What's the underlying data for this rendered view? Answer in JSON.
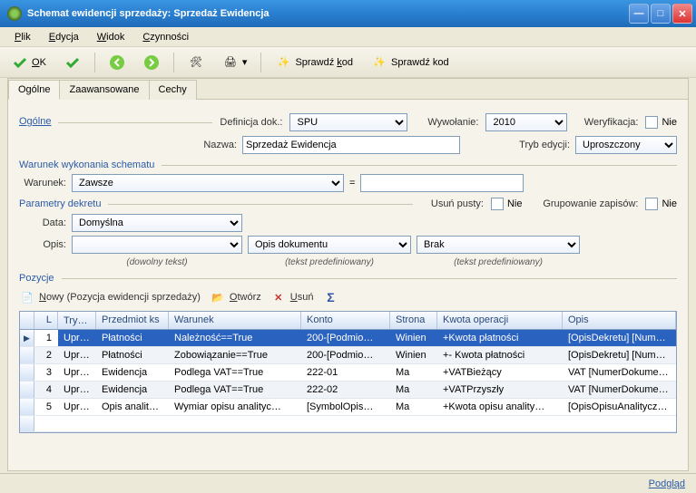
{
  "window": {
    "title": "Schemat ewidencji sprzedaży: Sprzedaż Ewidencja"
  },
  "menu": {
    "plik": "Plik",
    "edycja": "Edycja",
    "widok": "Widok",
    "czynnosci": "Czynności"
  },
  "toolbar": {
    "ok": "OK",
    "sprawdz_kod": "Sprawdź kod",
    "sprawdz_kod2": "Sprawdź kod"
  },
  "tabs": {
    "ogolne": "Ogólne",
    "zaawansowane": "Zaawansowane",
    "cechy": "Cechy"
  },
  "general": {
    "group_label": "Ogólne",
    "def_dok_label": "Definicja dok.:",
    "def_dok_value": "SPU",
    "wywolanie_label": "Wywołanie:",
    "wywolanie_value": "2010",
    "weryfikacja_label": "Weryfikacja:",
    "weryfikacja_value": "Nie",
    "nazwa_label": "Nazwa:",
    "nazwa_value": "Sprzedaż Ewidencja",
    "tryb_label": "Tryb edycji:",
    "tryb_value": "Uproszczony"
  },
  "warunek_group": {
    "label": "Warunek wykonania schematu",
    "warunek_label": "Warunek:",
    "warunek_value": "Zawsze",
    "eq": "=",
    "extra_value": ""
  },
  "parametry": {
    "label": "Parametry dekretu",
    "usun_label": "Usuń pusty:",
    "usun_value": "Nie",
    "grup_label": "Grupowanie zapisów:",
    "grup_value": "Nie",
    "data_label": "Data:",
    "data_value": "Domyślna",
    "opis_label": "Opis:",
    "opis1_value": "",
    "opis2_value": "Opis dokumentu",
    "opis3_value": "Brak",
    "hint1": "(dowolny tekst)",
    "hint2": "(tekst predefiniowany)",
    "hint3": "(tekst predefiniowany)"
  },
  "pozycje": {
    "label": "Pozycje",
    "nowy": "Nowy (Pozycja ewidencji sprzedaży)",
    "otworz": "Otwórz",
    "usun": "Usuń"
  },
  "grid": {
    "headers": {
      "l": "L",
      "tryb": "Tryb",
      "przedmiot": "Przedmiot ks",
      "warunek": "Warunek",
      "konto": "Konto",
      "strona": "Strona",
      "kwota": "Kwota operacji",
      "opis": "Opis"
    },
    "rows": [
      {
        "l": "1",
        "tryb": "Upr…",
        "przedmiot": "Płatności",
        "warunek": "Należność==True",
        "konto": "200-[Podmio…",
        "strona": "Winien",
        "kwota": "+Kwota płatności",
        "opis": "[OpisDekretu] [NumerDo…"
      },
      {
        "l": "2",
        "tryb": "Upr…",
        "przedmiot": "Płatności",
        "warunek": "Zobowiązanie==True",
        "konto": "200-[Podmio…",
        "strona": "Winien",
        "kwota": "+- Kwota płatności",
        "opis": "[OpisDekretu] [NumerDo…"
      },
      {
        "l": "3",
        "tryb": "Upr…",
        "przedmiot": "Ewidencja",
        "warunek": "Podlega VAT==True",
        "konto": "222-01",
        "strona": "Ma",
        "kwota": "+VATBieżący",
        "opis": "VAT [NumerDokumentu]"
      },
      {
        "l": "4",
        "tryb": "Upr…",
        "przedmiot": "Ewidencja",
        "warunek": "Podlega VAT==True",
        "konto": "222-02",
        "strona": "Ma",
        "kwota": "+VATPrzyszły",
        "opis": "VAT [NumerDokumentu]"
      },
      {
        "l": "5",
        "tryb": "Upr…",
        "przedmiot": "Opis analit…",
        "warunek": "Wymiar opisu analityc…",
        "konto": "[SymbolOpis…",
        "strona": "Ma",
        "kwota": "+Kwota opisu anality…",
        "opis": "[OpisOpisuAnalitycznego]…"
      }
    ]
  },
  "status": {
    "podglad": "Podgląd"
  }
}
